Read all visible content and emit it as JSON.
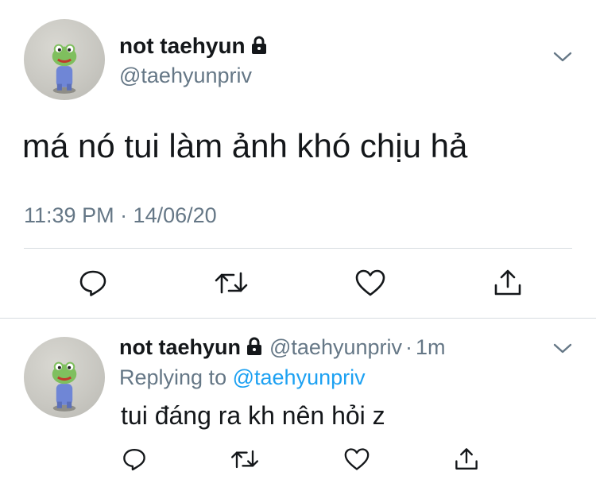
{
  "tweet": {
    "author_name": "not taehyun",
    "author_handle": "@taehyunpriv",
    "text": "má nó tui làm ảnh khó chịu hả",
    "time": "11:39 PM · 14/06/20",
    "icons": [
      "reply-icon",
      "retweet-icon",
      "like-icon",
      "share-icon",
      "lock-icon",
      "chevron-down-icon"
    ]
  },
  "reply": {
    "author_name": "not taehyun",
    "author_handle": "@taehyunpriv",
    "separator": "·",
    "age": "1m",
    "replying_prefix": "Replying to",
    "replying_to": "@taehyunpriv",
    "text": "tui đáng ra kh nên hỏi z"
  },
  "colors": {
    "text": "#14171a",
    "secondary": "#657786",
    "link": "#1da1f2",
    "divider": "#d6dbe0"
  }
}
